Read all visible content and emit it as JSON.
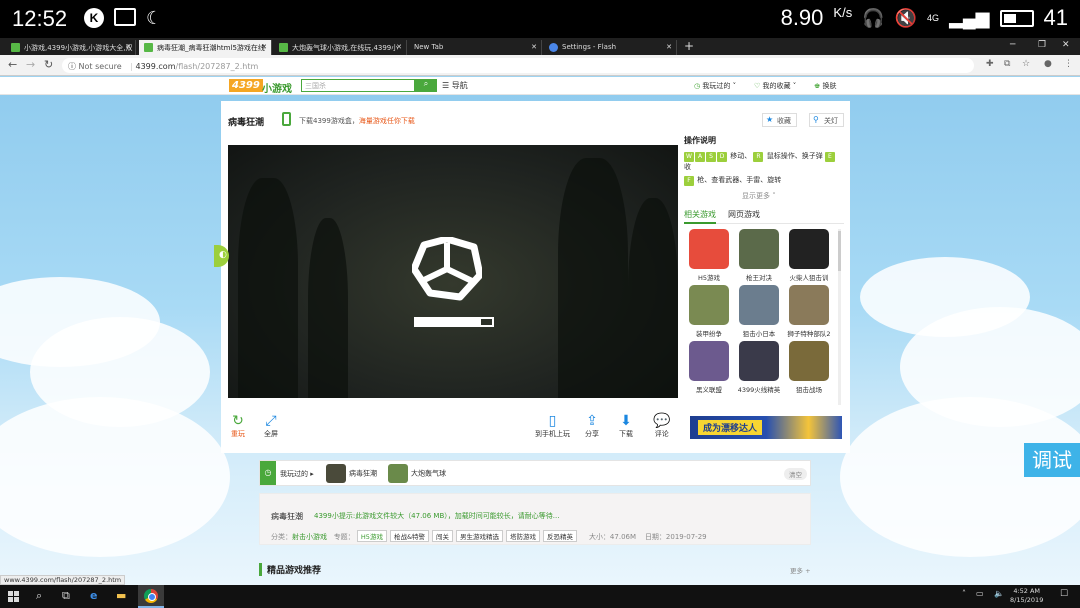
{
  "status_bar": {
    "time": "12:52",
    "k_badge": "K",
    "speed": "8.90",
    "speed_unit": "K/s",
    "network": "4G",
    "battery": "41"
  },
  "tabs": [
    {
      "title": "小游戏,4399小游戏,小游戏大全,双",
      "active": false
    },
    {
      "title": "病毒狂潮_病毒狂潮html5游戏在线",
      "active": true
    },
    {
      "title": "大炮轰气球小游戏,在线玩,4399小",
      "active": false
    },
    {
      "title": "New Tab",
      "active": false
    },
    {
      "title": "Settings - Flash",
      "active": false
    }
  ],
  "address": {
    "security": "Not secure",
    "host": "4399.com",
    "path": "/flash/207287_2.htm"
  },
  "site_header": {
    "logo_brand": "4399",
    "logo_sub": "小游戏",
    "search_placeholder": "三国杀",
    "nav_label": "导航",
    "played_label": "我玩过的",
    "fav_label": "我的收藏",
    "skin_label": "换肤"
  },
  "game": {
    "title": "病毒狂潮",
    "download_prefix": "下载4399游戏盒，",
    "download_highlight": "海量游戏任你下载",
    "collect_label": "收藏",
    "lights_label": "关灯"
  },
  "controls": {
    "replay": "重玩",
    "fullscreen": "全屏",
    "phone": "到手机上玩",
    "share": "分享",
    "download": "下载",
    "comment": "评论"
  },
  "loading": {
    "progress": 0.86
  },
  "right_panel": {
    "heading": "操作说明",
    "key_lines": [
      {
        "keys": [
          "W",
          "A",
          "S",
          "D"
        ],
        "text": "移动、"
      },
      {
        "keys": [
          "R"
        ],
        "text": "鼠标操作、换子弹"
      },
      {
        "keys": [
          "E"
        ],
        "text": "收"
      },
      {
        "keys": [
          "F"
        ],
        "text": "枪、查看武器、手雷、旋转"
      }
    ],
    "show_more": "显示更多",
    "tab_related": "相关游戏",
    "tab_web": "网页游戏",
    "games": [
      {
        "name": "H5游戏",
        "color": "#e74c3c"
      },
      {
        "name": "枪王对决",
        "color": "#5b6a4a"
      },
      {
        "name": "火柴人狙击训",
        "color": "#222222"
      },
      {
        "name": "装甲纷争",
        "color": "#7a8a52"
      },
      {
        "name": "狙击小日本",
        "color": "#6b7d8e"
      },
      {
        "name": "狮子特种部队2",
        "color": "#8a7a5a"
      },
      {
        "name": "黑义联盟",
        "color": "#6c5a8e"
      },
      {
        "name": "4399火线精英",
        "color": "#3a3a4a"
      },
      {
        "name": "狙击战场",
        "color": "#7a6a3a"
      }
    ],
    "ad_text": "成为漂移达人"
  },
  "debug_label": "调试",
  "played": {
    "label": "我玩过的",
    "games": [
      {
        "name": "病毒狂潮",
        "color": "#4a4a3a"
      },
      {
        "name": "大炮轰气球",
        "color": "#6a8a4a"
      }
    ],
    "clear": "清空"
  },
  "info": {
    "title": "病毒狂潮",
    "notice": "4399小提示:此游戏文件较大（47.06 MB），加载时间可能较长，请耐心等待...",
    "category_label": "分类：",
    "category": "射击小游戏",
    "topic_label": "专题：",
    "tags": [
      "H5游戏",
      "枪战&特警",
      "闯关",
      "男生游戏精选",
      "塔防游戏",
      "反恐精英"
    ],
    "size": "大小：47.06M",
    "date": "日期：2019-07-29"
  },
  "recommend": {
    "heading": "精品游戏推荐",
    "more": "更多 +"
  },
  "status_url": "www.4399.com/flash/207287_2.htm",
  "taskbar": {
    "time": "4:52 AM",
    "date": "8/15/2019"
  },
  "colors": {
    "brand_green": "#3a9a2e",
    "brand_orange": "#f5a623",
    "accent_blue": "#1b87e0"
  }
}
